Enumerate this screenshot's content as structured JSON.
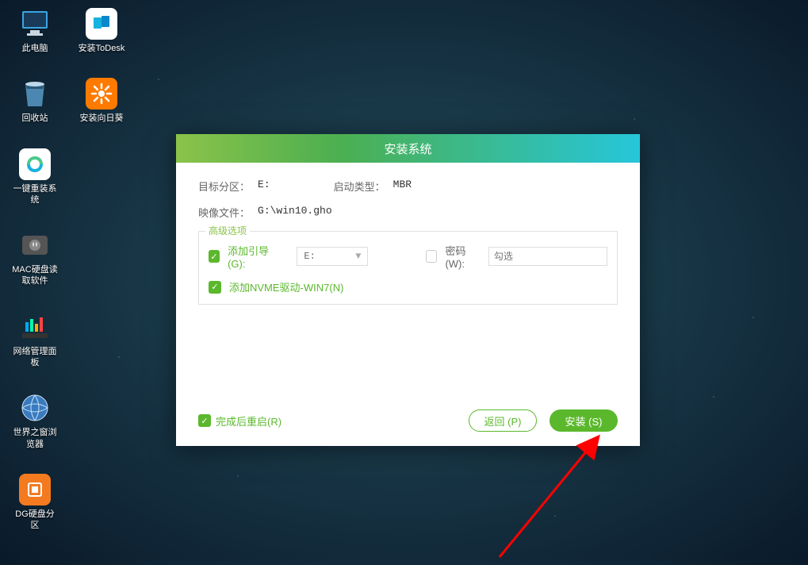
{
  "desktop": {
    "icons": [
      {
        "label": "此电脑"
      },
      {
        "label": "安装ToDesk"
      },
      {
        "label": "回收站"
      },
      {
        "label": "安装向日葵"
      },
      {
        "label": "一键重装系统"
      },
      {
        "label": "MAC硬盘读取软件"
      },
      {
        "label": "网络管理面板"
      },
      {
        "label": "世界之窗浏览器"
      },
      {
        "label": "DG硬盘分区"
      }
    ]
  },
  "dialog": {
    "title": "安装系统",
    "target_partition_label": "目标分区：",
    "target_partition_value": "E:",
    "boot_type_label": "启动类型：",
    "boot_type_value": "MBR",
    "image_file_label": "映像文件：",
    "image_file_value": "G:\\win10.gho",
    "advanced": {
      "legend": "高级选项",
      "add_boot_label": "添加引导(G):",
      "add_boot_value": "E:",
      "password_label": "密码(W):",
      "password_placeholder": "勾选",
      "nvme_label": "添加NVME驱动-WIN7(N)"
    },
    "restart_label": "完成后重启(R)",
    "back_btn": "返回 (P)",
    "install_btn": "安装 (S)"
  }
}
